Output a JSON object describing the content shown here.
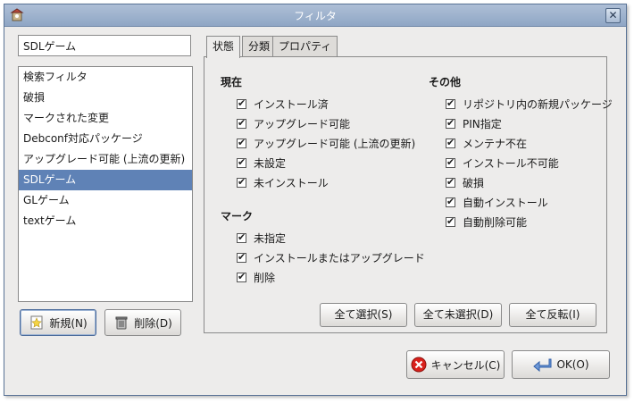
{
  "window": {
    "title": "フィルタ"
  },
  "search": {
    "value": "SDLゲーム"
  },
  "filter_list": {
    "items": [
      "検索フィルタ",
      "破損",
      "マークされた変更",
      "Debconf対応パッケージ",
      "アップグレード可能 (上流の更新)",
      "SDLゲーム",
      "GLゲーム",
      "textゲーム"
    ],
    "selected": "SDLゲーム"
  },
  "left_buttons": {
    "new_label": "新規(N)",
    "delete_label": "削除(D)"
  },
  "tabs": [
    "状態",
    "分類",
    "プロパティ"
  ],
  "active_tab": "状態",
  "status": {
    "current_title": "現在",
    "current": [
      "インストール済",
      "アップグレード可能",
      "アップグレード可能 (上流の更新)",
      "未設定",
      "未インストール"
    ],
    "mark_title": "マーク",
    "mark": [
      "未指定",
      "インストールまたはアップグレード",
      "削除"
    ],
    "other_title": "その他",
    "other": [
      "リポジトリ内の新規パッケージ",
      "PIN指定",
      "メンテナ不在",
      "インストール不可能",
      "破損",
      "自動インストール",
      "自動削除可能"
    ]
  },
  "select_buttons": {
    "select_all": "全て選択(S)",
    "deselect_all": "全て未選択(D)",
    "invert": "全て反転(I)"
  },
  "dialog_buttons": {
    "cancel": "キャンセル(C)",
    "ok": "OK(O)"
  },
  "colors": {
    "titlebar": "#9fb3cf",
    "selection": "#5f82b6",
    "cancel_icon": "#d9201b",
    "ok_icon": "#3a6fc4"
  }
}
